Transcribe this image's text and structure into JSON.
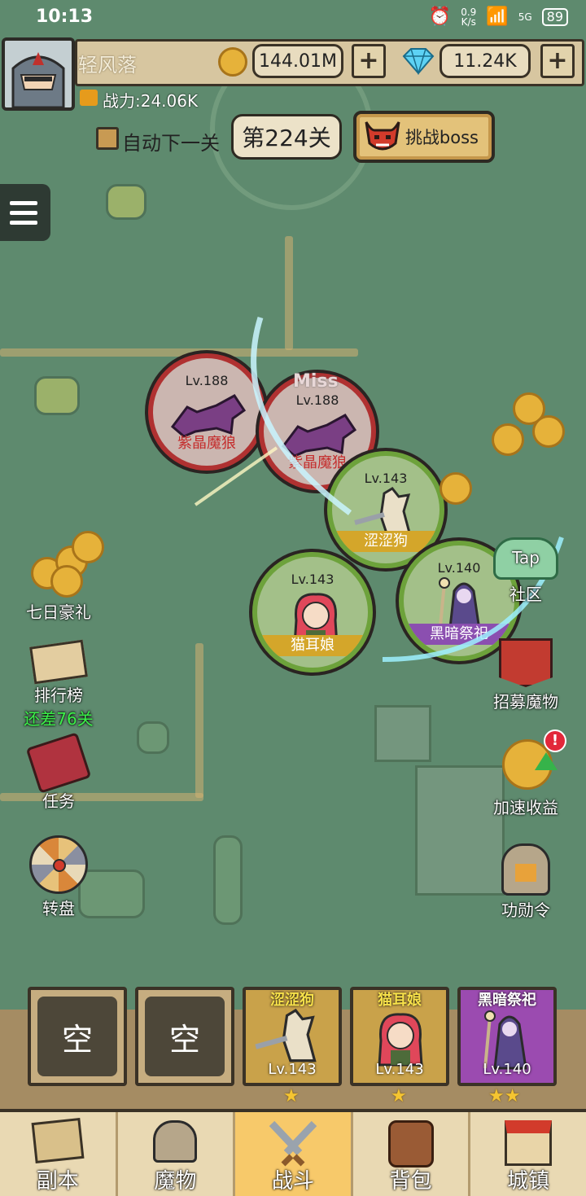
{
  "status_bar": {
    "time": "10:13",
    "net_speed_top": "0.9",
    "net_speed_unit": "K/s",
    "signal_label": "5G",
    "battery": "89"
  },
  "player": {
    "name": "轻风落",
    "power": "战力:24.06K"
  },
  "currency": {
    "gold": "144.01M",
    "gems": "11.24K",
    "add_symbol": "+"
  },
  "stage": {
    "auto_next_label": "自动下一关",
    "current_stage": "第224关",
    "boss_button": "挑战boss"
  },
  "battle": {
    "miss_text": "Miss",
    "enemies": [
      {
        "level": "Lv.188",
        "name": "紫晶魔狼"
      },
      {
        "level": "Lv.188",
        "name": "紫晶魔狼"
      }
    ],
    "allies": [
      {
        "level": "Lv.143",
        "name": "涩涩狗"
      },
      {
        "level": "Lv.143",
        "name": "猫耳娘"
      },
      {
        "level": "Lv.140",
        "name": "黑暗祭祀"
      }
    ]
  },
  "left_menu": {
    "seven_day": "七日豪礼",
    "ranking": "排行榜",
    "ranking_sub": "还差76关",
    "tasks": "任务",
    "wheel": "转盘"
  },
  "right_menu": {
    "community_tap": "Tap",
    "community": "社区",
    "recruit": "招募魔物",
    "speedup": "加速收益",
    "speedup_badge": "!",
    "merit": "功勋令"
  },
  "team_slots": [
    {
      "empty_label": "空"
    },
    {
      "empty_label": "空"
    },
    {
      "name": "涩涩狗",
      "level": "Lv.143",
      "stars": "★",
      "color": "#c9a24a"
    },
    {
      "name": "猫耳娘",
      "level": "Lv.143",
      "stars": "★",
      "color": "#c9a24a"
    },
    {
      "name": "黑暗祭祀",
      "level": "Lv.140",
      "stars": "★★",
      "color": "#9b4bb0"
    }
  ],
  "nav": [
    {
      "label": "副本",
      "active": false
    },
    {
      "label": "魔物",
      "active": false
    },
    {
      "label": "战斗",
      "active": true
    },
    {
      "label": "背包",
      "active": false
    },
    {
      "label": "城镇",
      "active": false
    }
  ],
  "colors": {
    "map_bg": "#5e8a6e",
    "enemy_ring": "#b03131",
    "ally_ring": "#6da23b",
    "nav_active": "#f7c96a"
  }
}
